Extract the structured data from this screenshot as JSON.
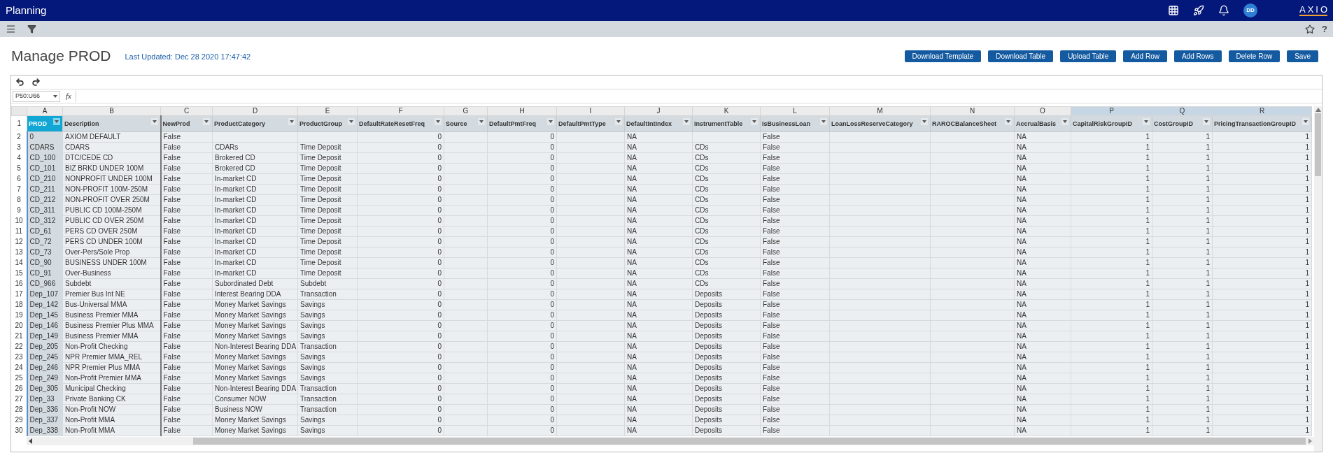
{
  "app_bar": {
    "title": "Planning",
    "avatar": "DD",
    "logo": "AXIO"
  },
  "toolbar": {
    "help": "?"
  },
  "page": {
    "title": "Manage PROD",
    "last_updated": "Last Updated: Dec 28 2020 17:47:42"
  },
  "buttons": [
    "Download Template",
    "Download Table",
    "Upload Table",
    "Add Row",
    "Add Rows",
    "Delete Row",
    "Save"
  ],
  "sheet": {
    "name_box": "P50:U66",
    "fx": "fx",
    "columns": [
      {
        "letter": "A",
        "header": "PROD",
        "kind": "text",
        "active": true,
        "highlighted": false
      },
      {
        "letter": "B",
        "header": "Description",
        "kind": "text",
        "active": false,
        "highlighted": false
      },
      {
        "letter": "C",
        "header": "NewProd",
        "kind": "text",
        "active": false,
        "highlighted": false
      },
      {
        "letter": "D",
        "header": "ProductCategory",
        "kind": "text",
        "active": false,
        "highlighted": false
      },
      {
        "letter": "E",
        "header": "ProductGroup",
        "kind": "text",
        "active": false,
        "highlighted": false
      },
      {
        "letter": "F",
        "header": "DefaultRateResetFreq",
        "kind": "number",
        "active": false,
        "highlighted": false
      },
      {
        "letter": "G",
        "header": "Source",
        "kind": "text",
        "active": false,
        "highlighted": false
      },
      {
        "letter": "H",
        "header": "DefaultPmtFreq",
        "kind": "number",
        "active": false,
        "highlighted": false
      },
      {
        "letter": "I",
        "header": "DefaultPmtType",
        "kind": "text",
        "active": false,
        "highlighted": false
      },
      {
        "letter": "J",
        "header": "DefaultIntIndex",
        "kind": "text",
        "active": false,
        "highlighted": false
      },
      {
        "letter": "K",
        "header": "InstrumentTable",
        "kind": "text",
        "active": false,
        "highlighted": false
      },
      {
        "letter": "L",
        "header": "IsBusinessLoan",
        "kind": "text",
        "active": false,
        "highlighted": false
      },
      {
        "letter": "M",
        "header": "LoanLossReserveCategory",
        "kind": "text",
        "active": false,
        "highlighted": false
      },
      {
        "letter": "N",
        "header": "RAROCBalanceSheet",
        "kind": "text",
        "active": false,
        "highlighted": false
      },
      {
        "letter": "O",
        "header": "AccrualBasis",
        "kind": "text",
        "active": false,
        "highlighted": false
      },
      {
        "letter": "P",
        "header": "CapitalRiskGroupID",
        "kind": "number",
        "active": false,
        "highlighted": true
      },
      {
        "letter": "Q",
        "header": "CostGroupID",
        "kind": "number",
        "active": false,
        "highlighted": true
      },
      {
        "letter": "R",
        "header": "PricingTransactionGroupID",
        "kind": "number",
        "active": false,
        "highlighted": true
      }
    ],
    "header_row": "1",
    "rows": [
      {
        "number": "2",
        "cells": [
          "0",
          "AXIOM DEFAULT",
          "False",
          null,
          null,
          "0",
          null,
          "0",
          null,
          "NA",
          null,
          "False",
          null,
          null,
          "NA",
          "1",
          "1",
          "1"
        ]
      },
      {
        "number": "3",
        "cells": [
          "CDARS",
          "CDARS",
          "False",
          "CDARs",
          "Time Deposit",
          "0",
          null,
          "0",
          null,
          "NA",
          "CDs",
          "False",
          null,
          null,
          "NA",
          "1",
          "1",
          "1"
        ]
      },
      {
        "number": "4",
        "cells": [
          "CD_100",
          "DTC/CEDE CD",
          "False",
          "Brokered CD",
          "Time Deposit",
          "0",
          null,
          "0",
          null,
          "NA",
          "CDs",
          "False",
          null,
          null,
          "NA",
          "1",
          "1",
          "1"
        ]
      },
      {
        "number": "5",
        "cells": [
          "CD_101",
          "BIZ BRKD UNDER 100M",
          "False",
          "Brokered CD",
          "Time Deposit",
          "0",
          null,
          "0",
          null,
          "NA",
          "CDs",
          "False",
          null,
          null,
          "NA",
          "1",
          "1",
          "1"
        ]
      },
      {
        "number": "6",
        "cells": [
          "CD_210",
          "NONPROFIT UNDER 100M",
          "False",
          "In-market CD",
          "Time Deposit",
          "0",
          null,
          "0",
          null,
          "NA",
          "CDs",
          "False",
          null,
          null,
          "NA",
          "1",
          "1",
          "1"
        ]
      },
      {
        "number": "7",
        "cells": [
          "CD_211",
          "NON-PROFIT 100M-250M",
          "False",
          "In-market CD",
          "Time Deposit",
          "0",
          null,
          "0",
          null,
          "NA",
          "CDs",
          "False",
          null,
          null,
          "NA",
          "1",
          "1",
          "1"
        ]
      },
      {
        "number": "8",
        "cells": [
          "CD_212",
          "NON-PROFIT OVER 250M",
          "False",
          "In-market CD",
          "Time Deposit",
          "0",
          null,
          "0",
          null,
          "NA",
          "CDs",
          "False",
          null,
          null,
          "NA",
          "1",
          "1",
          "1"
        ]
      },
      {
        "number": "9",
        "cells": [
          "CD_311",
          "PUBLIC CD 100M-250M",
          "False",
          "In-market CD",
          "Time Deposit",
          "0",
          null,
          "0",
          null,
          "NA",
          "CDs",
          "False",
          null,
          null,
          "NA",
          "1",
          "1",
          "1"
        ]
      },
      {
        "number": "10",
        "cells": [
          "CD_312",
          "PUBLIC CD OVER 250M",
          "False",
          "In-market CD",
          "Time Deposit",
          "0",
          null,
          "0",
          null,
          "NA",
          "CDs",
          "False",
          null,
          null,
          "NA",
          "1",
          "1",
          "1"
        ]
      },
      {
        "number": "11",
        "cells": [
          "CD_61",
          "PERS CD OVER 250M",
          "False",
          "In-market CD",
          "Time Deposit",
          "0",
          null,
          "0",
          null,
          "NA",
          "CDs",
          "False",
          null,
          null,
          "NA",
          "1",
          "1",
          "1"
        ]
      },
      {
        "number": "12",
        "cells": [
          "CD_72",
          "PERS CD UNDER 100M",
          "False",
          "In-market CD",
          "Time Deposit",
          "0",
          null,
          "0",
          null,
          "NA",
          "CDs",
          "False",
          null,
          null,
          "NA",
          "1",
          "1",
          "1"
        ]
      },
      {
        "number": "13",
        "cells": [
          "CD_73",
          "Over-Pers/Sole Prop",
          "False",
          "In-market CD",
          "Time Deposit",
          "0",
          null,
          "0",
          null,
          "NA",
          "CDs",
          "False",
          null,
          null,
          "NA",
          "1",
          "1",
          "1"
        ]
      },
      {
        "number": "14",
        "cells": [
          "CD_90",
          "BUSINESS UNDER 100M",
          "False",
          "In-market CD",
          "Time Deposit",
          "0",
          null,
          "0",
          null,
          "NA",
          "CDs",
          "False",
          null,
          null,
          "NA",
          "1",
          "1",
          "1"
        ]
      },
      {
        "number": "15",
        "cells": [
          "CD_91",
          "Over-Business",
          "False",
          "In-market CD",
          "Time Deposit",
          "0",
          null,
          "0",
          null,
          "NA",
          "CDs",
          "False",
          null,
          null,
          "NA",
          "1",
          "1",
          "1"
        ]
      },
      {
        "number": "16",
        "cells": [
          "CD_966",
          "Subdebt",
          "False",
          "Subordinated Debt",
          "Subdebt",
          "0",
          null,
          "0",
          null,
          "NA",
          "CDs",
          "False",
          null,
          null,
          "NA",
          "1",
          "1",
          "1"
        ]
      },
      {
        "number": "17",
        "cells": [
          "Dep_107",
          "Premier Bus Int NE",
          "False",
          "Interest Bearing DDA",
          "Transaction",
          "0",
          null,
          "0",
          null,
          "NA",
          "Deposits",
          "False",
          null,
          null,
          "NA",
          "1",
          "1",
          "1"
        ]
      },
      {
        "number": "18",
        "cells": [
          "Dep_142",
          "Bus-Universal MMA",
          "False",
          "Money Market Savings",
          "Savings",
          "0",
          null,
          "0",
          null,
          "NA",
          "Deposits",
          "False",
          null,
          null,
          "NA",
          "1",
          "1",
          "1"
        ]
      },
      {
        "number": "19",
        "cells": [
          "Dep_145",
          "Business Premier MMA",
          "False",
          "Money Market Savings",
          "Savings",
          "0",
          null,
          "0",
          null,
          "NA",
          "Deposits",
          "False",
          null,
          null,
          "NA",
          "1",
          "1",
          "1"
        ]
      },
      {
        "number": "20",
        "cells": [
          "Dep_146",
          "Business Premier Plus MMA",
          "False",
          "Money Market Savings",
          "Savings",
          "0",
          null,
          "0",
          null,
          "NA",
          "Deposits",
          "False",
          null,
          null,
          "NA",
          "1",
          "1",
          "1"
        ]
      },
      {
        "number": "21",
        "cells": [
          "Dep_149",
          "Business Premier MMA",
          "False",
          "Money Market Savings",
          "Savings",
          "0",
          null,
          "0",
          null,
          "NA",
          "Deposits",
          "False",
          null,
          null,
          "NA",
          "1",
          "1",
          "1"
        ]
      },
      {
        "number": "22",
        "cells": [
          "Dep_205",
          "Non-Profit Checking",
          "False",
          "Non-Interest Bearing DDA",
          "Transaction",
          "0",
          null,
          "0",
          null,
          "NA",
          "Deposits",
          "False",
          null,
          null,
          "NA",
          "1",
          "1",
          "1"
        ]
      },
      {
        "number": "23",
        "cells": [
          "Dep_245",
          "NPR Premier MMA_REL",
          "False",
          "Money Market Savings",
          "Savings",
          "0",
          null,
          "0",
          null,
          "NA",
          "Deposits",
          "False",
          null,
          null,
          "NA",
          "1",
          "1",
          "1"
        ]
      },
      {
        "number": "24",
        "cells": [
          "Dep_246",
          "NPR Premier Plus MMA",
          "False",
          "Money Market Savings",
          "Savings",
          "0",
          null,
          "0",
          null,
          "NA",
          "Deposits",
          "False",
          null,
          null,
          "NA",
          "1",
          "1",
          "1"
        ]
      },
      {
        "number": "25",
        "cells": [
          "Dep_249",
          "Non-Profit Premier MMA",
          "False",
          "Money Market Savings",
          "Savings",
          "0",
          null,
          "0",
          null,
          "NA",
          "Deposits",
          "False",
          null,
          null,
          "NA",
          "1",
          "1",
          "1"
        ]
      },
      {
        "number": "26",
        "cells": [
          "Dep_305",
          "Municipal Checking",
          "False",
          "Non-Interest Bearing DDA",
          "Transaction",
          "0",
          null,
          "0",
          null,
          "NA",
          "Deposits",
          "False",
          null,
          null,
          "NA",
          "1",
          "1",
          "1"
        ]
      },
      {
        "number": "27",
        "cells": [
          "Dep_33",
          "Private Banking CK",
          "False",
          "Consumer NOW",
          "Transaction",
          "0",
          null,
          "0",
          null,
          "NA",
          "Deposits",
          "False",
          null,
          null,
          "NA",
          "1",
          "1",
          "1"
        ]
      },
      {
        "number": "28",
        "cells": [
          "Dep_336",
          "Non-Profit NOW",
          "False",
          "Business NOW",
          "Transaction",
          "0",
          null,
          "0",
          null,
          "NA",
          "Deposits",
          "False",
          null,
          null,
          "NA",
          "1",
          "1",
          "1"
        ]
      },
      {
        "number": "29",
        "cells": [
          "Dep_337",
          "Non-Profit MMA",
          "False",
          "Money Market Savings",
          "Savings",
          "0",
          null,
          "0",
          null,
          "NA",
          "Deposits",
          "False",
          null,
          null,
          "NA",
          "1",
          "1",
          "1"
        ]
      },
      {
        "number": "30",
        "cells": [
          "Dep_338",
          "Non-Profit MMA",
          "False",
          "Money Market Savings",
          "Savings",
          "0",
          null,
          "0",
          null,
          "NA",
          "Deposits",
          "False",
          null,
          null,
          "NA",
          "1",
          "1",
          "1"
        ]
      }
    ]
  }
}
